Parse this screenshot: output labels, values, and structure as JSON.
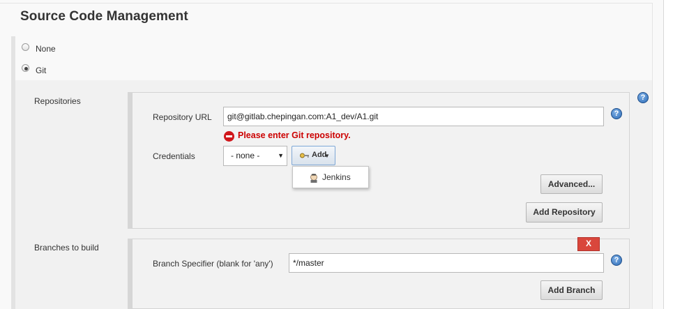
{
  "section": {
    "title": "Source Code Management"
  },
  "scm_options": [
    {
      "label": "None",
      "selected": false
    },
    {
      "label": "Git",
      "selected": true
    }
  ],
  "repositories": {
    "label": "Repositories",
    "url_label": "Repository URL",
    "url_value": "git@gitlab.chepingan.com:A1_dev/A1.git",
    "error_text": "Please enter Git repository.",
    "credentials_label": "Credentials",
    "credentials_value": "- none -",
    "add_label": "Add",
    "add_menu": [
      {
        "label": "Jenkins",
        "icon": "jenkins-icon"
      }
    ],
    "advanced_label": "Advanced...",
    "add_repository_label": "Add Repository"
  },
  "branches": {
    "label": "Branches to build",
    "delete_label": "X",
    "specifier_label": "Branch Specifier (blank for 'any')",
    "specifier_value": "*/master",
    "add_branch_label": "Add Branch"
  },
  "help_icon": "?",
  "colors": {
    "error": "#cc0000",
    "help_blue": "#2d6cb7",
    "delete_red": "#d9473c"
  }
}
